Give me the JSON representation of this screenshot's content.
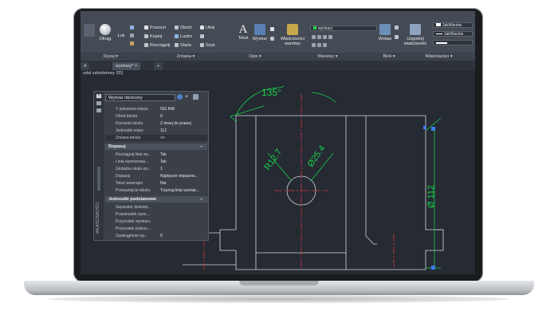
{
  "ribbon": {
    "draw_tools": [
      {
        "label": "Okrąg",
        "icon": "circle-icon"
      },
      {
        "label": "Łuk",
        "icon": "arc-icon"
      }
    ],
    "modify_tools": [
      {
        "label": "Przesuń",
        "icon": "move-icon"
      },
      {
        "label": "Obróć",
        "icon": "rotate-icon"
      },
      {
        "label": "Utnij",
        "icon": "trim-icon"
      },
      {
        "label": "Kopiuj",
        "icon": "copy-icon"
      },
      {
        "label": "Lustro",
        "icon": "mirror-icon"
      },
      {
        "label": "Rozciągnij",
        "icon": "stretch-icon"
      },
      {
        "label": "Skala",
        "icon": "scale-icon"
      },
      {
        "label": "Szyk",
        "icon": "array-icon"
      }
    ],
    "text_tool": "Tekst",
    "dimension_tool": "Wymiar",
    "layer_props": "Właściwości warstwy",
    "layer_combo": "wymiary",
    "insert_tool": "Wstaw",
    "match_props": "Uzgodnij właściwości",
    "bylayer_1": "JakWarstw",
    "bylayer_2": "JakWarstw",
    "panel_labels": [
      "Rysuj",
      "Zmiana",
      "Opis",
      "Warstwy",
      "Blok",
      "Właściwości"
    ]
  },
  "tabs": {
    "first": "rt",
    "active": "wymiary*",
    "add_symbol": "+"
  },
  "viewport_label": "odel szkieletowy 2D]",
  "palette": {
    "combo": "Wymiar obrócony",
    "title": "WŁAŚCIWOŚCI",
    "rows_top": [
      {
        "k": "Y położenia tekstu",
        "v": "592.848"
      },
      {
        "k": "Obrót tekstu",
        "v": "0"
      },
      {
        "k": "Kierunek tekstu",
        "v": "Z lewej do prawej"
      },
      {
        "k": "Jednostki miary",
        "v": "112"
      },
      {
        "k": "Zmiana tekstu",
        "v": "<>"
      }
    ],
    "section_fit": "Dopasuj",
    "rows_fit": [
      {
        "k": "Rozciągnij linię wy...",
        "v": "Tak"
      },
      {
        "k": "Linia wymiarowa...",
        "v": "Tak"
      },
      {
        "k": "Globalna skala wy...",
        "v": "1"
      },
      {
        "k": "Dopasuj",
        "v": "Najlepsze dopasow..."
      },
      {
        "k": "Tekst wewnątrz",
        "v": "Nie"
      },
      {
        "k": "Przesunięcie tekstu",
        "v": "Trzymaj linię wymiar..."
      }
    ],
    "section_units": "Jednostki podstawowe",
    "rows_units": [
      {
        "k": "Separator dziesięt...",
        "v": ""
      },
      {
        "k": "Przedrostek wym...",
        "v": ""
      },
      {
        "k": "Przyrostek wymiaru",
        "v": ""
      },
      {
        "k": "Przyrostek jednos...",
        "v": ""
      },
      {
        "k": "Zaokrąglenie wy...",
        "v": "0"
      }
    ]
  },
  "drawing": {
    "angle_dim": "135°",
    "radius_dim": "R12.7",
    "diameter_dim": "Ø25.4",
    "vertical_dim": "Ø 112",
    "colors": {
      "outline": "#d6d8dc",
      "dimension": "#19d14a",
      "center": "#d8333a",
      "grip": "#3d7df2"
    }
  }
}
